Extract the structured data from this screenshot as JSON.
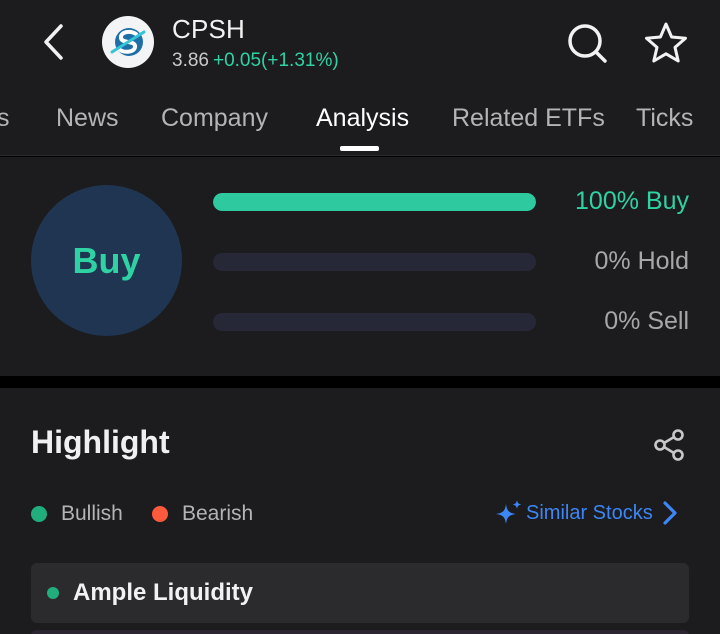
{
  "header": {
    "ticker": "CPSH",
    "price": "3.86",
    "change": "+0.05(+1.31%)"
  },
  "tabs": [
    {
      "label": "s"
    },
    {
      "label": "News"
    },
    {
      "label": "Company"
    },
    {
      "label": "Analysis",
      "active": true
    },
    {
      "label": "Related ETFs"
    },
    {
      "label": "Ticks"
    }
  ],
  "rating": {
    "consensus": "Buy",
    "bars": [
      {
        "label": "100% Buy",
        "fraction": 1.0
      },
      {
        "label": "0% Hold",
        "fraction": 0.0
      },
      {
        "label": "0% Sell",
        "fraction": 0.0
      }
    ]
  },
  "highlight": {
    "title": "Highlight",
    "legend": [
      {
        "label": "Bullish",
        "color": "#1fae7c"
      },
      {
        "label": "Bearish",
        "color": "#ff5a3c"
      }
    ],
    "similar_label": "Similar Stocks",
    "items": [
      {
        "label": "Ample Liquidity",
        "sentiment": "bullish"
      }
    ]
  },
  "colors": {
    "up": "#2fd3a3",
    "accent_link": "#3d86f5",
    "circle_bg": "#1f3552"
  }
}
